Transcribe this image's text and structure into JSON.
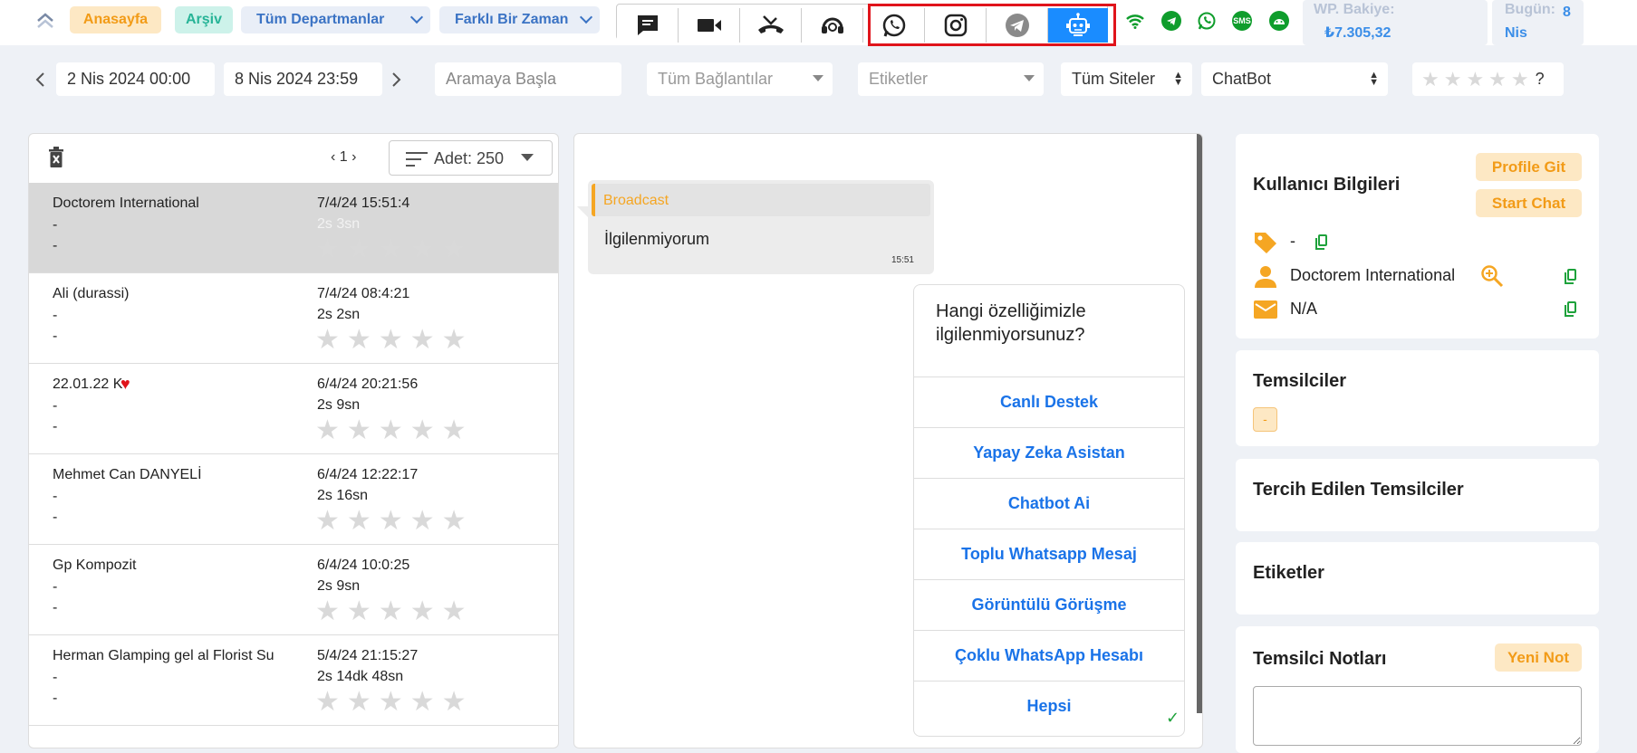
{
  "topbar": {
    "home": "Anasayfa",
    "archive": "Arşiv",
    "departments": "Tüm Departmanlar",
    "time_range": "Farklı Bir Zaman",
    "wp_balance_label": "WP. Bakiye:",
    "wp_balance_value": "₺7.305,32",
    "today_label": "Bugün:",
    "today_value": "8 Nis",
    "channels": [
      "chat-icon",
      "video-icon",
      "missed-call-icon",
      "headset-icon",
      "whatsapp-icon",
      "instagram-icon",
      "telegram-icon",
      "robot-icon"
    ],
    "status_icons": [
      "wifi-icon",
      "telegram-status-icon",
      "whatsapp-status-icon",
      "sms-icon",
      "android-icon"
    ],
    "sms_text": "SMS",
    "highlight_color": "#e0141b",
    "active_color": "#1a8cff"
  },
  "filters": {
    "start_date": "2 Nis 2024 00:00",
    "end_date": "8 Nis 2024 23:59",
    "search_placeholder": "Aramaya Başla",
    "connections": "Tüm Bağlantılar",
    "tags": "Etiketler",
    "sites": "Tüm Siteler",
    "bot": "ChatBot",
    "rating_q": "?"
  },
  "list": {
    "page": "1",
    "count_label": "Adet: 250",
    "rows": [
      {
        "name": "Doctorem International",
        "d1": "-",
        "d2": "-",
        "time": "7/4/24 15:51:4",
        "dur": "2s 3sn"
      },
      {
        "name": "Ali (durassi)",
        "d1": "-",
        "d2": "-",
        "time": "7/4/24 08:4:21",
        "dur": "2s 2sn"
      },
      {
        "name": "22.01.22 K",
        "d1": "-",
        "d2": "-",
        "time": "6/4/24 20:21:56",
        "dur": "2s 9sn"
      },
      {
        "name": "Mehmet Can DANYELİ",
        "d1": "-",
        "d2": "-",
        "time": "6/4/24 12:22:17",
        "dur": "2s 16sn"
      },
      {
        "name": "Gp Kompozit",
        "d1": "-",
        "d2": "-",
        "time": "6/4/24 10:0:25",
        "dur": "2s 9sn"
      },
      {
        "name": "Herman Glamping gel al Florist Su",
        "d1": "-",
        "d2": "-",
        "time": "5/4/24 21:15:27",
        "dur": "2s 14dk 48sn"
      }
    ]
  },
  "chat": {
    "broadcast_label": "Broadcast",
    "incoming_text": "İlgilenmiyorum",
    "incoming_time": "15:51",
    "bot_question": "Hangi özelliğimizle ilgilenmiyorsunuz?",
    "options": [
      "Canlı Destek",
      "Yapay Zeka Asistan",
      "Chatbot Ai",
      "Toplu Whatsapp Mesaj",
      "Görüntülü Görüşme",
      "Çoklu WhatsApp Hesabı",
      "Hepsi"
    ],
    "check": "✓"
  },
  "user_info": {
    "title": "Kullanıcı Bilgileri",
    "profile_btn": "Profile Git",
    "start_chat_btn": "Start Chat",
    "tag_value": "-",
    "name_value": "Doctorem International",
    "email_value": "N/A"
  },
  "representatives": {
    "title": "Temsilciler",
    "badge": "-"
  },
  "preferred": {
    "title": "Tercih Edilen Temsilciler"
  },
  "labels": {
    "title": "Etiketler"
  },
  "notes": {
    "title": "Temsilci Notları",
    "new_btn": "Yeni Not"
  }
}
